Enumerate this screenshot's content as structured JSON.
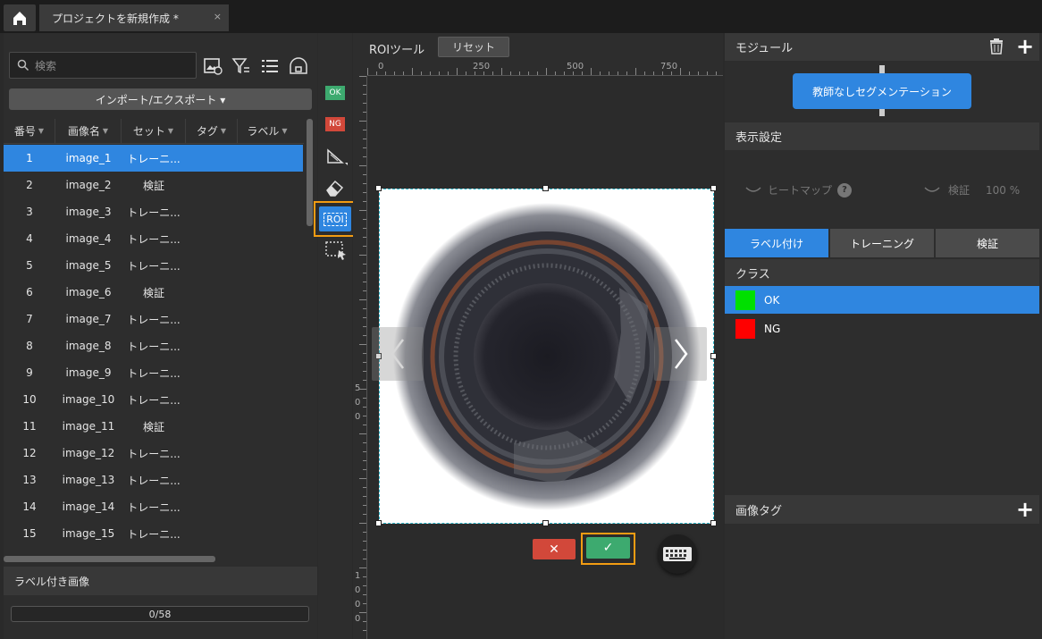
{
  "tabbar": {
    "home_icon": "home-icon",
    "doc_tab_title": "プロジェクトを新規作成 *",
    "close": "×"
  },
  "left": {
    "search_placeholder": "検索",
    "toolbar_icons": [
      "image-settings-icon",
      "filter-icon",
      "list-icon",
      "camera-icon"
    ],
    "import_export_label": "インポート/エクスポート ▾",
    "columns": [
      "番号",
      "画像名",
      "セット",
      "タグ",
      "ラベル"
    ],
    "rows": [
      {
        "no": "1",
        "name": "image_1",
        "set": "トレーニ..."
      },
      {
        "no": "2",
        "name": "image_2",
        "set": "検証"
      },
      {
        "no": "3",
        "name": "image_3",
        "set": "トレーニ..."
      },
      {
        "no": "4",
        "name": "image_4",
        "set": "トレーニ..."
      },
      {
        "no": "5",
        "name": "image_5",
        "set": "トレーニ..."
      },
      {
        "no": "6",
        "name": "image_6",
        "set": "検証"
      },
      {
        "no": "7",
        "name": "image_7",
        "set": "トレーニ..."
      },
      {
        "no": "8",
        "name": "image_8",
        "set": "トレーニ..."
      },
      {
        "no": "9",
        "name": "image_9",
        "set": "トレーニ..."
      },
      {
        "no": "10",
        "name": "image_10",
        "set": "トレーニ..."
      },
      {
        "no": "11",
        "name": "image_11",
        "set": "検証"
      },
      {
        "no": "12",
        "name": "image_12",
        "set": "トレーニ..."
      },
      {
        "no": "13",
        "name": "image_13",
        "set": "トレーニ..."
      },
      {
        "no": "14",
        "name": "image_14",
        "set": "トレーニ..."
      },
      {
        "no": "15",
        "name": "image_15",
        "set": "トレーニ..."
      }
    ],
    "selected_row": 0,
    "labeled_images_title": "ラベル付き画像",
    "labeled_progress": "0/58"
  },
  "tools": {
    "ok": "OK",
    "ng": "NG",
    "roi": "ROI"
  },
  "canvas": {
    "tool_title": "ROIツール",
    "reset_label": "リセット",
    "ruler_h_labels": [
      "0",
      "250",
      "500",
      "750"
    ],
    "ruler_v_labels": [
      "5",
      "0",
      "0",
      "1",
      "0",
      "0",
      "0"
    ],
    "cancel": "✕",
    "confirm": "✓",
    "keyboard_icon": "keyboard-icon"
  },
  "right": {
    "module_title": "モジュール",
    "module_button": "教師なしセグメンテーション",
    "display_title": "表示設定",
    "heatmap_label": "ヒートマップ",
    "help": "?",
    "validation_label": "検証",
    "validation_percent": "100 %",
    "tabs": [
      "ラベル付け",
      "トレーニング",
      "検証"
    ],
    "active_tab": 0,
    "class_title": "クラス",
    "classes": [
      {
        "name": "OK",
        "color": "#00e000",
        "selected": true
      },
      {
        "name": "NG",
        "color": "#ff0000",
        "selected": false
      }
    ],
    "image_tag_title": "画像タグ"
  },
  "colors": {
    "accent": "#2f86e0",
    "highlight": "#f39c12",
    "ok": "#3daa6f",
    "ng": "#d2483a"
  }
}
